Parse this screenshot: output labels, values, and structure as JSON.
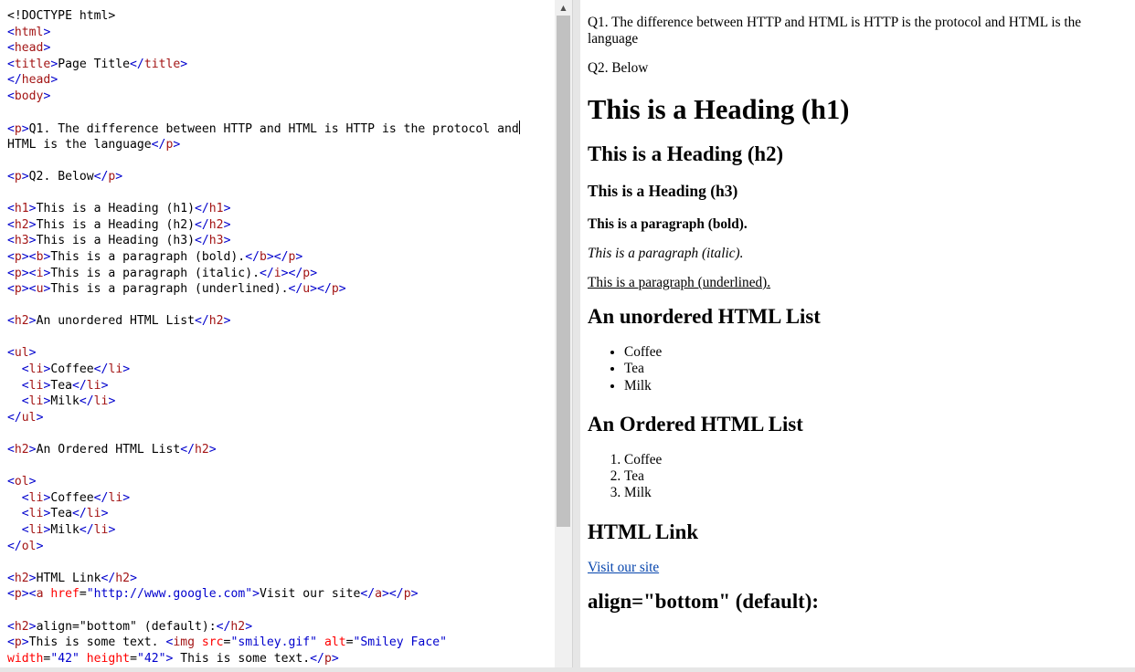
{
  "editor": {
    "lines": [
      [
        [
          "p",
          "<!DOCTYPE html>"
        ]
      ],
      [
        [
          "b",
          "<"
        ],
        [
          "t",
          "html"
        ],
        [
          "b",
          ">"
        ]
      ],
      [
        [
          "b",
          "<"
        ],
        [
          "t",
          "head"
        ],
        [
          "b",
          ">"
        ]
      ],
      [
        [
          "b",
          "<"
        ],
        [
          "t",
          "title"
        ],
        [
          "b",
          ">"
        ],
        [
          "p",
          "Page Title"
        ],
        [
          "b",
          "</"
        ],
        [
          "t",
          "title"
        ],
        [
          "b",
          ">"
        ]
      ],
      [
        [
          "b",
          "</"
        ],
        [
          "t",
          "head"
        ],
        [
          "b",
          ">"
        ]
      ],
      [
        [
          "b",
          "<"
        ],
        [
          "t",
          "body"
        ],
        [
          "b",
          ">"
        ]
      ],
      [],
      [
        [
          "b",
          "<"
        ],
        [
          "t",
          "p"
        ],
        [
          "b",
          ">"
        ],
        [
          "p",
          "Q1. The difference between HTTP and HTML is HTTP is the protocol and"
        ],
        [
          "c",
          ""
        ]
      ],
      [
        [
          "p",
          "HTML is the language"
        ],
        [
          "b",
          "</"
        ],
        [
          "t",
          "p"
        ],
        [
          "b",
          ">"
        ]
      ],
      [],
      [
        [
          "b",
          "<"
        ],
        [
          "t",
          "p"
        ],
        [
          "b",
          ">"
        ],
        [
          "p",
          "Q2. Below"
        ],
        [
          "b",
          "</"
        ],
        [
          "t",
          "p"
        ],
        [
          "b",
          ">"
        ]
      ],
      [],
      [
        [
          "b",
          "<"
        ],
        [
          "t",
          "h1"
        ],
        [
          "b",
          ">"
        ],
        [
          "p",
          "This is a Heading (h1)"
        ],
        [
          "b",
          "</"
        ],
        [
          "t",
          "h1"
        ],
        [
          "b",
          ">"
        ]
      ],
      [
        [
          "b",
          "<"
        ],
        [
          "t",
          "h2"
        ],
        [
          "b",
          ">"
        ],
        [
          "p",
          "This is a Heading (h2)"
        ],
        [
          "b",
          "</"
        ],
        [
          "t",
          "h2"
        ],
        [
          "b",
          ">"
        ]
      ],
      [
        [
          "b",
          "<"
        ],
        [
          "t",
          "h3"
        ],
        [
          "b",
          ">"
        ],
        [
          "p",
          "This is a Heading (h3)"
        ],
        [
          "b",
          "</"
        ],
        [
          "t",
          "h3"
        ],
        [
          "b",
          ">"
        ]
      ],
      [
        [
          "b",
          "<"
        ],
        [
          "t",
          "p"
        ],
        [
          "b",
          "><"
        ],
        [
          "t",
          "b"
        ],
        [
          "b",
          ">"
        ],
        [
          "p",
          "This is a paragraph (bold)."
        ],
        [
          "b",
          "</"
        ],
        [
          "t",
          "b"
        ],
        [
          "b",
          "></"
        ],
        [
          "t",
          "p"
        ],
        [
          "b",
          ">"
        ]
      ],
      [
        [
          "b",
          "<"
        ],
        [
          "t",
          "p"
        ],
        [
          "b",
          "><"
        ],
        [
          "t",
          "i"
        ],
        [
          "b",
          ">"
        ],
        [
          "p",
          "This is a paragraph (italic)."
        ],
        [
          "b",
          "</"
        ],
        [
          "t",
          "i"
        ],
        [
          "b",
          "></"
        ],
        [
          "t",
          "p"
        ],
        [
          "b",
          ">"
        ]
      ],
      [
        [
          "b",
          "<"
        ],
        [
          "t",
          "p"
        ],
        [
          "b",
          "><"
        ],
        [
          "t",
          "u"
        ],
        [
          "b",
          ">"
        ],
        [
          "p",
          "This is a paragraph (underlined)."
        ],
        [
          "b",
          "</"
        ],
        [
          "t",
          "u"
        ],
        [
          "b",
          "></"
        ],
        [
          "t",
          "p"
        ],
        [
          "b",
          ">"
        ]
      ],
      [],
      [
        [
          "b",
          "<"
        ],
        [
          "t",
          "h2"
        ],
        [
          "b",
          ">"
        ],
        [
          "p",
          "An unordered HTML List"
        ],
        [
          "b",
          "</"
        ],
        [
          "t",
          "h2"
        ],
        [
          "b",
          ">"
        ]
      ],
      [],
      [
        [
          "b",
          "<"
        ],
        [
          "t",
          "ul"
        ],
        [
          "b",
          ">"
        ]
      ],
      [
        [
          "p",
          "  "
        ],
        [
          "b",
          "<"
        ],
        [
          "t",
          "li"
        ],
        [
          "b",
          ">"
        ],
        [
          "p",
          "Coffee"
        ],
        [
          "b",
          "</"
        ],
        [
          "t",
          "li"
        ],
        [
          "b",
          ">"
        ]
      ],
      [
        [
          "p",
          "  "
        ],
        [
          "b",
          "<"
        ],
        [
          "t",
          "li"
        ],
        [
          "b",
          ">"
        ],
        [
          "p",
          "Tea"
        ],
        [
          "b",
          "</"
        ],
        [
          "t",
          "li"
        ],
        [
          "b",
          ">"
        ]
      ],
      [
        [
          "p",
          "  "
        ],
        [
          "b",
          "<"
        ],
        [
          "t",
          "li"
        ],
        [
          "b",
          ">"
        ],
        [
          "p",
          "Milk"
        ],
        [
          "b",
          "</"
        ],
        [
          "t",
          "li"
        ],
        [
          "b",
          ">"
        ]
      ],
      [
        [
          "b",
          "</"
        ],
        [
          "t",
          "ul"
        ],
        [
          "b",
          ">"
        ]
      ],
      [],
      [
        [
          "b",
          "<"
        ],
        [
          "t",
          "h2"
        ],
        [
          "b",
          ">"
        ],
        [
          "p",
          "An Ordered HTML List"
        ],
        [
          "b",
          "</"
        ],
        [
          "t",
          "h2"
        ],
        [
          "b",
          ">"
        ]
      ],
      [],
      [
        [
          "b",
          "<"
        ],
        [
          "t",
          "ol"
        ],
        [
          "b",
          ">"
        ]
      ],
      [
        [
          "p",
          "  "
        ],
        [
          "b",
          "<"
        ],
        [
          "t",
          "li"
        ],
        [
          "b",
          ">"
        ],
        [
          "p",
          "Coffee"
        ],
        [
          "b",
          "</"
        ],
        [
          "t",
          "li"
        ],
        [
          "b",
          ">"
        ]
      ],
      [
        [
          "p",
          "  "
        ],
        [
          "b",
          "<"
        ],
        [
          "t",
          "li"
        ],
        [
          "b",
          ">"
        ],
        [
          "p",
          "Tea"
        ],
        [
          "b",
          "</"
        ],
        [
          "t",
          "li"
        ],
        [
          "b",
          ">"
        ]
      ],
      [
        [
          "p",
          "  "
        ],
        [
          "b",
          "<"
        ],
        [
          "t",
          "li"
        ],
        [
          "b",
          ">"
        ],
        [
          "p",
          "Milk"
        ],
        [
          "b",
          "</"
        ],
        [
          "t",
          "li"
        ],
        [
          "b",
          ">"
        ]
      ],
      [
        [
          "b",
          "</"
        ],
        [
          "t",
          "ol"
        ],
        [
          "b",
          ">"
        ]
      ],
      [],
      [
        [
          "b",
          "<"
        ],
        [
          "t",
          "h2"
        ],
        [
          "b",
          ">"
        ],
        [
          "p",
          "HTML Link"
        ],
        [
          "b",
          "</"
        ],
        [
          "t",
          "h2"
        ],
        [
          "b",
          ">"
        ]
      ],
      [
        [
          "b",
          "<"
        ],
        [
          "t",
          "p"
        ],
        [
          "b",
          "><"
        ],
        [
          "t",
          "a"
        ],
        [
          "p",
          " "
        ],
        [
          "a",
          "href"
        ],
        [
          "p",
          "="
        ],
        [
          "v",
          "\"http://www.google.com\""
        ],
        [
          "b",
          ">"
        ],
        [
          "p",
          "Visit our site"
        ],
        [
          "b",
          "</"
        ],
        [
          "t",
          "a"
        ],
        [
          "b",
          "></"
        ],
        [
          "t",
          "p"
        ],
        [
          "b",
          ">"
        ]
      ],
      [],
      [
        [
          "b",
          "<"
        ],
        [
          "t",
          "h2"
        ],
        [
          "b",
          ">"
        ],
        [
          "p",
          "align=\"bottom\" (default):"
        ],
        [
          "b",
          "</"
        ],
        [
          "t",
          "h2"
        ],
        [
          "b",
          ">"
        ]
      ],
      [
        [
          "b",
          "<"
        ],
        [
          "t",
          "p"
        ],
        [
          "b",
          ">"
        ],
        [
          "p",
          "This is some text. "
        ],
        [
          "b",
          "<"
        ],
        [
          "t",
          "img"
        ],
        [
          "p",
          " "
        ],
        [
          "a",
          "src"
        ],
        [
          "p",
          "="
        ],
        [
          "v",
          "\"smiley.gif\""
        ],
        [
          "p",
          " "
        ],
        [
          "a",
          "alt"
        ],
        [
          "p",
          "="
        ],
        [
          "v",
          "\"Smiley Face\""
        ]
      ],
      [
        [
          "a",
          "width"
        ],
        [
          "p",
          "="
        ],
        [
          "v",
          "\"42\""
        ],
        [
          "p",
          " "
        ],
        [
          "a",
          "height"
        ],
        [
          "p",
          "="
        ],
        [
          "v",
          "\"42\""
        ],
        [
          "b",
          ">"
        ],
        [
          "p",
          " This is some text."
        ],
        [
          "b",
          "</"
        ],
        [
          "t",
          "p"
        ],
        [
          "b",
          ">"
        ]
      ]
    ],
    "scroll_up_glyph": "▲"
  },
  "result": {
    "q1": "Q1. The difference between HTTP and HTML is HTTP is the protocol and HTML is the language",
    "q2": "Q2. Below",
    "h1": "This is a Heading (h1)",
    "h2": "This is a Heading (h2)",
    "h3": "This is a Heading (h3)",
    "bold_para": "This is a paragraph (bold).",
    "italic_para": "This is a paragraph (italic).",
    "underlined_para": "This is a paragraph (underlined).",
    "unordered_heading": "An unordered HTML List",
    "unordered_items": [
      "Coffee",
      "Tea",
      "Milk"
    ],
    "ordered_heading": "An Ordered HTML List",
    "ordered_items": [
      "Coffee",
      "Tea",
      "Milk"
    ],
    "link_heading": "HTML Link",
    "link_text": "Visit our site",
    "link_href": "http://www.google.com",
    "align_heading": "align=\"bottom\" (default):"
  }
}
